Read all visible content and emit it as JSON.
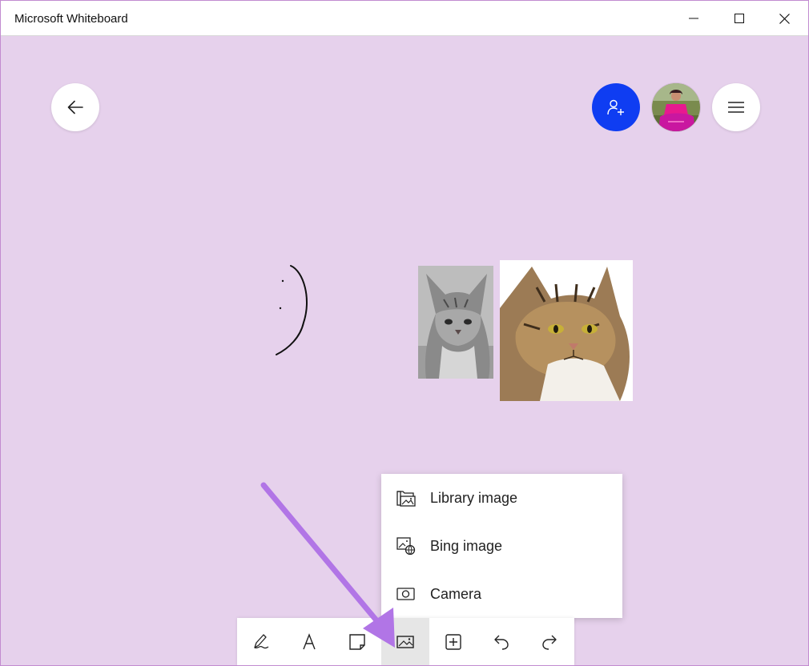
{
  "app": {
    "title": "Microsoft Whiteboard"
  },
  "window_controls": {
    "minimize_icon": "minimize-icon",
    "maximize_icon": "maximize-icon",
    "close_icon": "close-icon"
  },
  "top_controls": {
    "back_icon": "arrow-left-icon",
    "invite_icon": "person-add-icon",
    "invite_color": "#0f3df2",
    "menu_icon": "hamburger-menu-icon"
  },
  "canvas": {
    "background": "#e6d1ec"
  },
  "image_menu": {
    "items": [
      {
        "label": "Library image",
        "icon": "folder-image-icon"
      },
      {
        "label": "Bing image",
        "icon": "image-globe-icon"
      },
      {
        "label": "Camera",
        "icon": "camera-icon"
      }
    ]
  },
  "toolbar": {
    "tools": [
      {
        "name": "pen",
        "icon": "pen-icon"
      },
      {
        "name": "text",
        "icon": "text-icon"
      },
      {
        "name": "note",
        "icon": "sticky-note-icon"
      },
      {
        "name": "image",
        "icon": "image-icon",
        "active": true
      },
      {
        "name": "insert",
        "icon": "plus-box-icon"
      },
      {
        "name": "undo",
        "icon": "undo-icon"
      },
      {
        "name": "redo",
        "icon": "redo-icon"
      }
    ]
  },
  "highlight_arrow_color": "#b175e6"
}
